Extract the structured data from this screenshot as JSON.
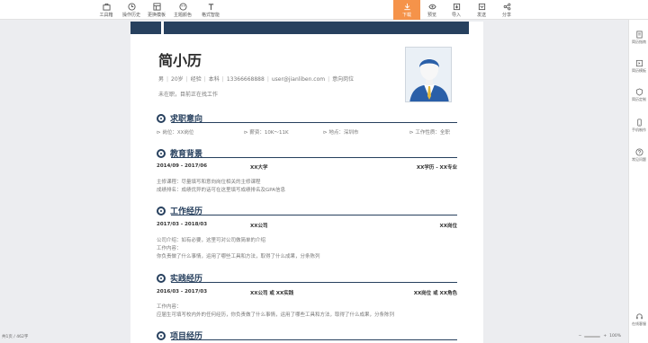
{
  "toolbar": {
    "items": [
      "工具箱",
      "操作历史",
      "更换模板",
      "主题颜色",
      "格式智能"
    ],
    "actions": [
      "下载",
      "预览",
      "导入",
      "发送",
      "分享"
    ]
  },
  "sidebar": {
    "items": [
      "简历指南",
      "简历模板",
      "简历定制",
      "手机制作",
      "常见问题"
    ],
    "bottom": "在线客服"
  },
  "status": {
    "left": "共1页 / 462字",
    "zoom": "100%"
  },
  "resume": {
    "name": "简小历",
    "info": [
      "男",
      "20岁",
      "经验",
      "本科",
      "13366668888",
      "user@jianliben.com",
      "意向岗位"
    ],
    "status_line": "未在职，目前正在找工作",
    "sections": {
      "intent": {
        "title": "求职意向",
        "fields": [
          "岗位：XX岗位",
          "薪资：10K～11K",
          "地点：深圳市",
          "工作性质：全职"
        ]
      },
      "education": {
        "title": "教育背景",
        "date": "2014/09 - 2017/06",
        "school": "XX大学",
        "major": "XX学历 - XX专业",
        "line1": "主修课程：尽量填写和意向岗位相关的主修课程",
        "line2": "成绩排名：成绩优异的话可在这里填写成绩排名及GPA信息"
      },
      "work": {
        "title": "工作经历",
        "date": "2017/03 - 2018/03",
        "company": "XX公司",
        "position": "XX岗位",
        "line1": "公司介绍：如有必要，这里可对公司做简单的介绍",
        "line2": "工作内容：",
        "line3": "你负责做了什么事情，运用了哪些工具和方法，取得了什么成果，分条陈列"
      },
      "practice": {
        "title": "实践经历",
        "date": "2016/03 - 2017/03",
        "org": "XX公司 或 XX实践",
        "role": "XX岗位 或 XX角色",
        "line1": "工作内容：",
        "line2": "应届生可填写校内外的任何经历，你负责做了什么事情，运用了哪些工具和方法，取得了什么成果，分条陈列"
      },
      "projects": {
        "title": "项目经历"
      }
    }
  },
  "colors": {
    "theme": "#27405e",
    "active": "#f5934a"
  }
}
